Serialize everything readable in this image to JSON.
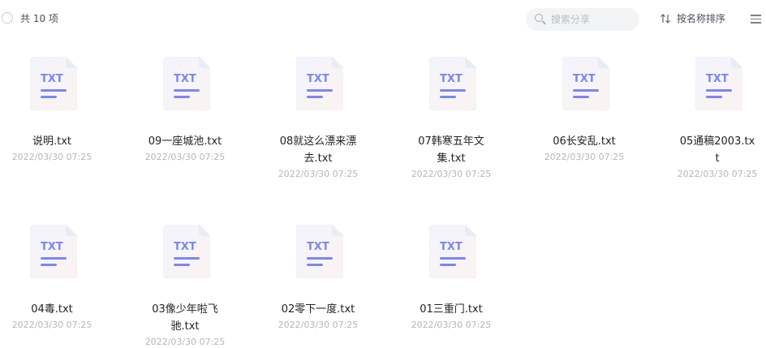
{
  "toolbar": {
    "count_label": "共 10 项",
    "search_placeholder": "搜索分享",
    "sort_label": "按名称排序"
  },
  "icons": {
    "file_icon": "txt-file-icon",
    "search": "search-icon",
    "sort": "sort-arrows-icon",
    "menu": "hamburger-menu-icon",
    "select_all": "checkbox-circle-icon"
  },
  "file_type_label": "TXT",
  "files": [
    {
      "name": "说明.txt",
      "date": "2022/03/30 07:25"
    },
    {
      "name": "09一座城池.txt",
      "date": "2022/03/30 07:25"
    },
    {
      "name": "08就这么漂来漂去.txt",
      "date": "2022/03/30 07:25"
    },
    {
      "name": "07韩寒五年文集.txt",
      "date": "2022/03/30 07:25"
    },
    {
      "name": "06长安乱.txt",
      "date": "2022/03/30 07:25"
    },
    {
      "name": "05通稿2003.txt",
      "date": "2022/03/30 07:25"
    },
    {
      "name": "04毒.txt",
      "date": "2022/03/30 07:25"
    },
    {
      "name": "03像少年啦飞驰.txt",
      "date": "2022/03/30 07:25"
    },
    {
      "name": "02零下一度.txt",
      "date": "2022/03/30 07:25"
    },
    {
      "name": "01三重门.txt",
      "date": "2022/03/30 07:25"
    }
  ],
  "colors": {
    "icon_accent": "#7b86f3",
    "icon_bg": "#f6f7fb",
    "date_text": "#b3b6bd"
  }
}
